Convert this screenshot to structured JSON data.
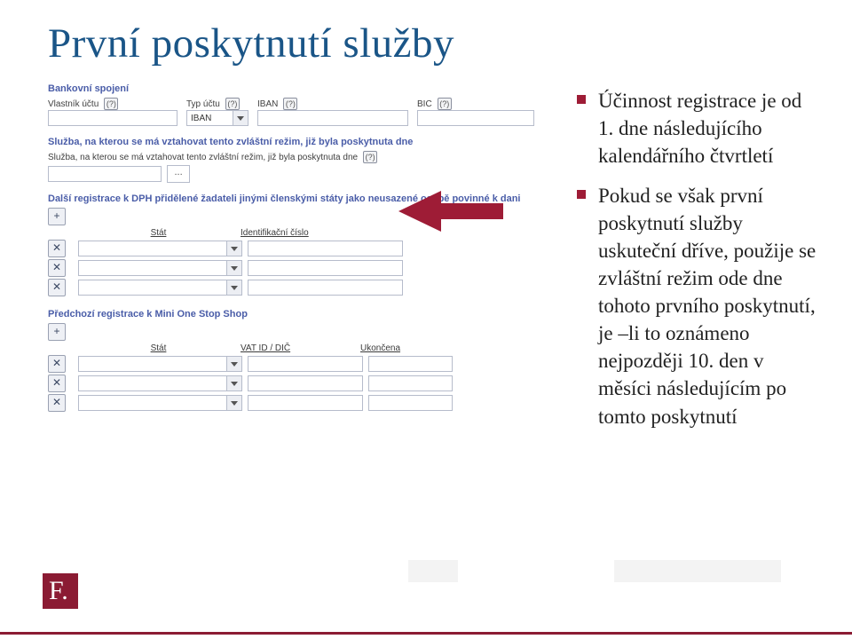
{
  "title": "První poskytnutí služby",
  "bullets": [
    "Účinnost registrace je od 1. dne následujícího kalendářního čtvrtletí",
    "Pokud se však první poskytnutí služby uskuteční dříve, použije se zvláštní režim ode dne tohoto prvního poskytnutí, je –li to oznámeno nejpozději 10. den v měsíci následujícím po tomto poskytnutí"
  ],
  "form": {
    "bank_section": "Bankovní spojení",
    "owner_label": "Vlastník účtu",
    "type_label": "Typ účtu",
    "iban_label": "IBAN",
    "bic_label": "BIC",
    "iban_value": "IBAN",
    "service_line1": "Služba, na kterou se má vztahovat tento zvláštní režim, již byla poskytnuta dne",
    "service_line2": "Služba, na kterou se má vztahovat tento zvláštní režim, již byla poskytnuta dne",
    "further_reg": "Další registrace k DPH přidělené žadateli jinými členskými státy jako neusazené osobě povinné k dani",
    "state_hdr": "Stát",
    "id_hdr": "Identifikační číslo",
    "prev_reg": "Předchozí registrace k Mini One Stop Shop",
    "vat_hdr": "VAT ID / DIČ",
    "ended_hdr": "Ukončena",
    "q": "(?)",
    "ellipsis": "...",
    "plus": "+",
    "x": "✕"
  },
  "logo": "F."
}
